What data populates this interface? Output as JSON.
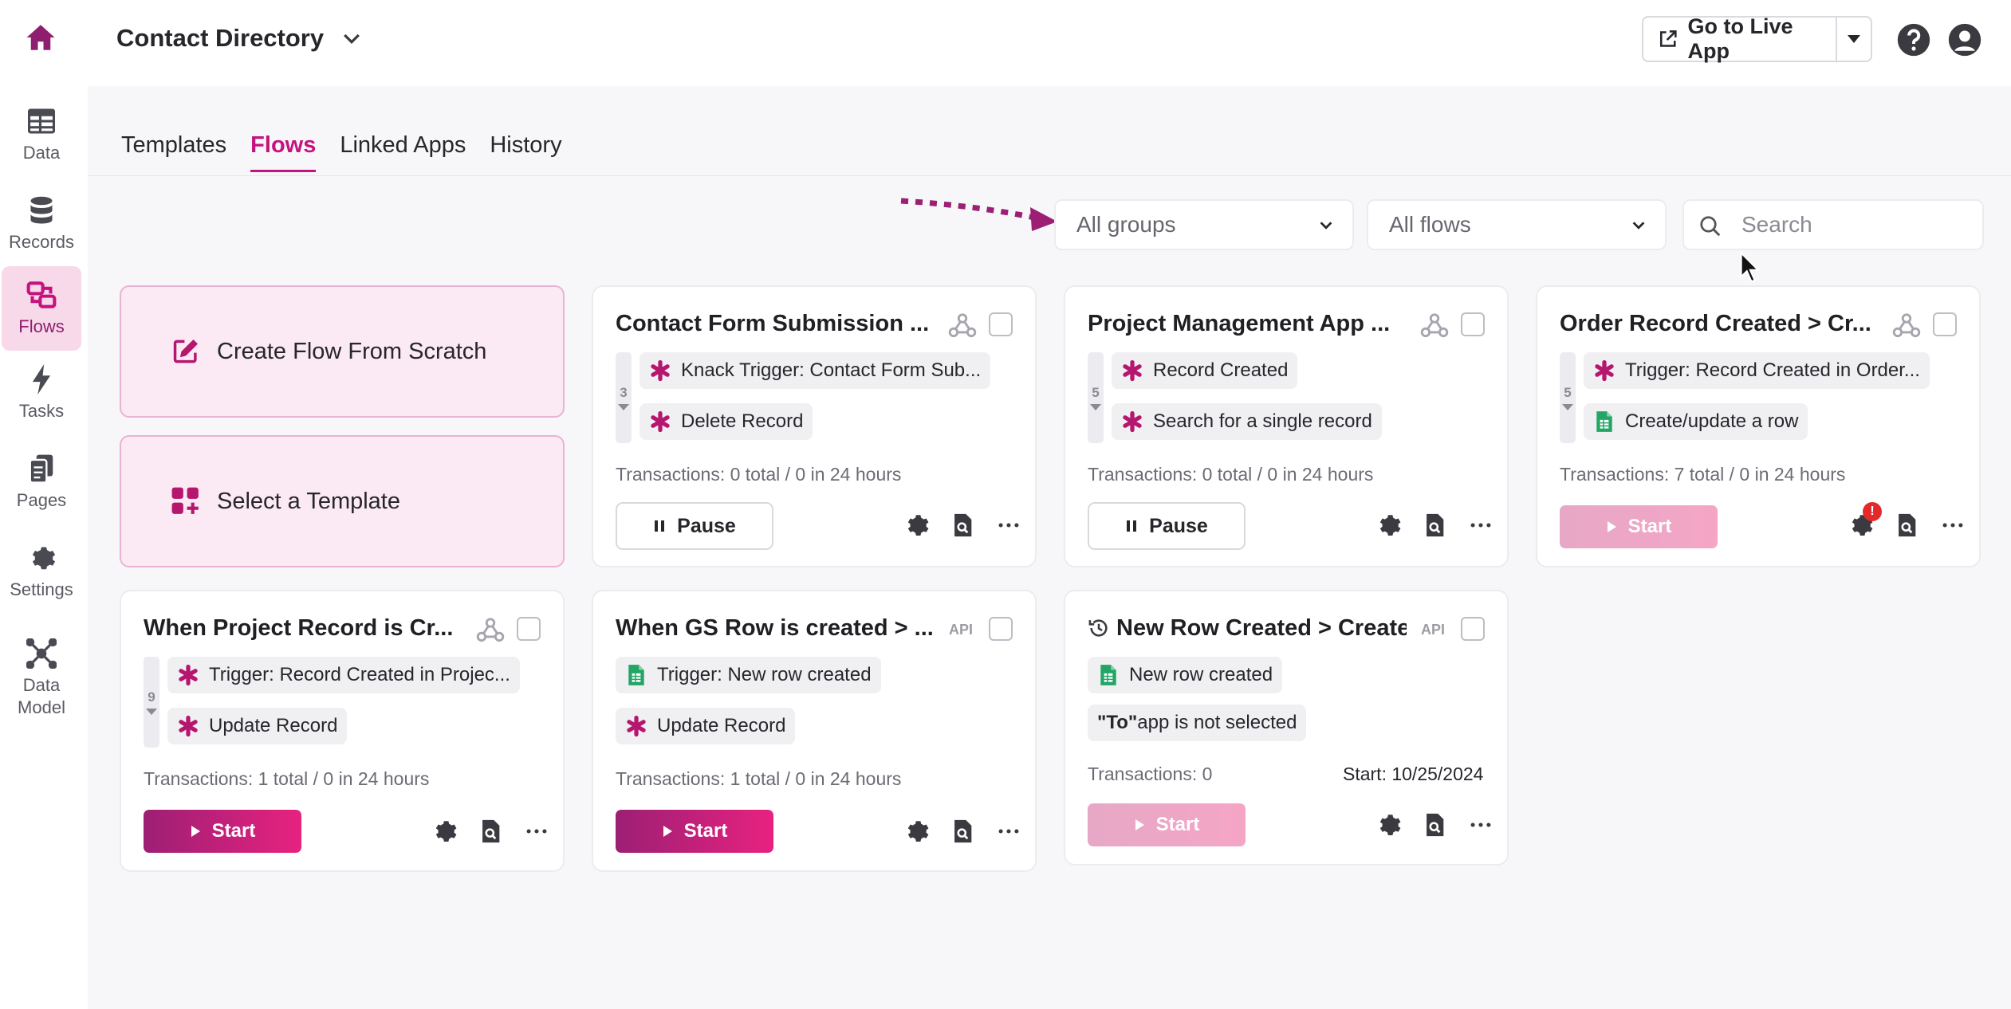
{
  "app": {
    "title": "Contact Directory"
  },
  "rail": [
    {
      "label": "Data",
      "icon": "table-icon"
    },
    {
      "label": "Records",
      "icon": "database-icon"
    },
    {
      "label": "Flows",
      "icon": "flows-icon",
      "active": true
    },
    {
      "label": "Tasks",
      "icon": "bolt-icon"
    },
    {
      "label": "Pages",
      "icon": "pages-icon"
    },
    {
      "label": "Settings",
      "icon": "gear-icon"
    },
    {
      "label": "Data\nModel",
      "icon": "data-model-icon"
    }
  ],
  "header": {
    "live_button": "Go to Live App"
  },
  "tabs": [
    {
      "label": "Templates"
    },
    {
      "label": "Flows",
      "active": true
    },
    {
      "label": "Linked Apps"
    },
    {
      "label": "History"
    }
  ],
  "filters": {
    "groups": "All groups",
    "flows": "All flows",
    "search_placeholder": "Search"
  },
  "create": {
    "scratch": "Create Flow From Scratch",
    "template": "Select a Template"
  },
  "cards": [
    {
      "title": "Contact Form Submission ...",
      "badge": "webhook",
      "steps_count": "3",
      "steps": [
        {
          "icon": "knack",
          "text": "Knack Trigger: Contact Form Sub..."
        },
        {
          "icon": "knack",
          "text": "Delete Record"
        }
      ],
      "transactions": "Transactions: 0 total / 0 in 24 hours",
      "action": "Pause"
    },
    {
      "title": "Project Management App ...",
      "badge": "webhook",
      "steps_count": "5",
      "steps": [
        {
          "icon": "knack",
          "text": "Record Created"
        },
        {
          "icon": "knack",
          "text": "Search for a single record"
        }
      ],
      "transactions": "Transactions: 0 total / 0 in 24 hours",
      "action": "Pause"
    },
    {
      "title": "Order Record Created > Cr...",
      "badge": "webhook",
      "steps_count": "5",
      "steps": [
        {
          "icon": "knack",
          "text": "Trigger: Record Created in Order..."
        },
        {
          "icon": "sheets",
          "text": "Create/update a row"
        }
      ],
      "transactions": "Transactions: 7 total / 0 in 24 hours",
      "action": "Start",
      "alert": "!"
    },
    {
      "title": "When Project Record is Cr...",
      "badge": "webhook",
      "steps_count": "9",
      "steps": [
        {
          "icon": "knack",
          "text": "Trigger: Record Created in Projec..."
        },
        {
          "icon": "knack",
          "text": "Update Record"
        }
      ],
      "transactions": "Transactions: 1 total / 0 in 24 hours",
      "action": "Start"
    },
    {
      "title": "When GS Row is created > ...",
      "badge": "API",
      "steps": [
        {
          "icon": "sheets",
          "text": "Trigger: New row created"
        },
        {
          "icon": "knack",
          "text": "Update Record"
        }
      ],
      "transactions": "Transactions: 1 total / 0 in 24 hours",
      "action": "Start"
    },
    {
      "title": "New Row Created > Create...",
      "badge": "API",
      "steps": [
        {
          "icon": "sheets",
          "text": "New row created"
        }
      ],
      "note_bold": "\"To\"",
      "note_rest": " app is not selected",
      "transactions": "Transactions: 0",
      "start_date": "Start: 10/25/2024",
      "action": "Start"
    }
  ],
  "colors": {
    "brand": "#c4137e",
    "brand_dark": "#9c1f74",
    "sheets_green": "#22a565",
    "alert": "#e22a2a"
  }
}
